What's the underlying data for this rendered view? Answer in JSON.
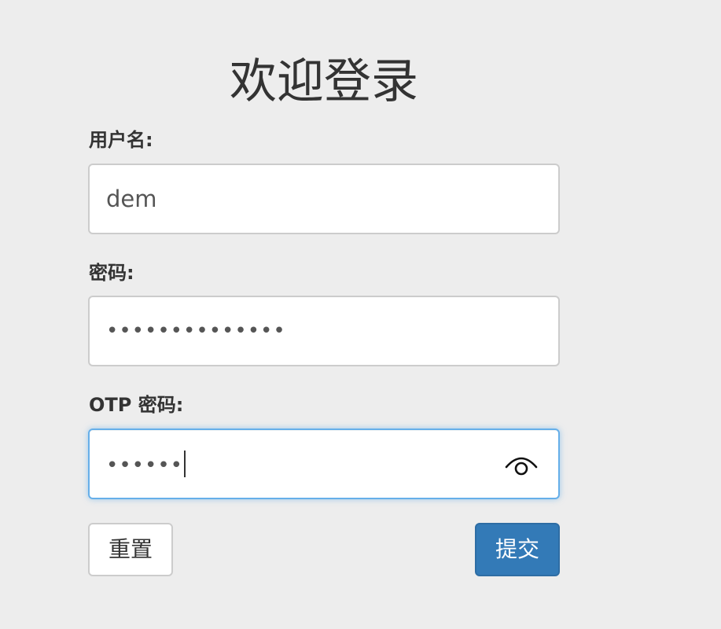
{
  "title": "欢迎登录",
  "form": {
    "username": {
      "label": "用户名:",
      "value": "dem"
    },
    "password": {
      "label": "密码:",
      "masked_value": "••••••••••••••"
    },
    "otp": {
      "label": "OTP 密码:",
      "masked_value": "••••••",
      "toggle_icon": "eye-icon"
    }
  },
  "buttons": {
    "reset_label": "重置",
    "submit_label": "提交"
  },
  "colors": {
    "background": "#ededed",
    "submit_bg": "#337ab7",
    "focus_border": "#66afe9"
  }
}
